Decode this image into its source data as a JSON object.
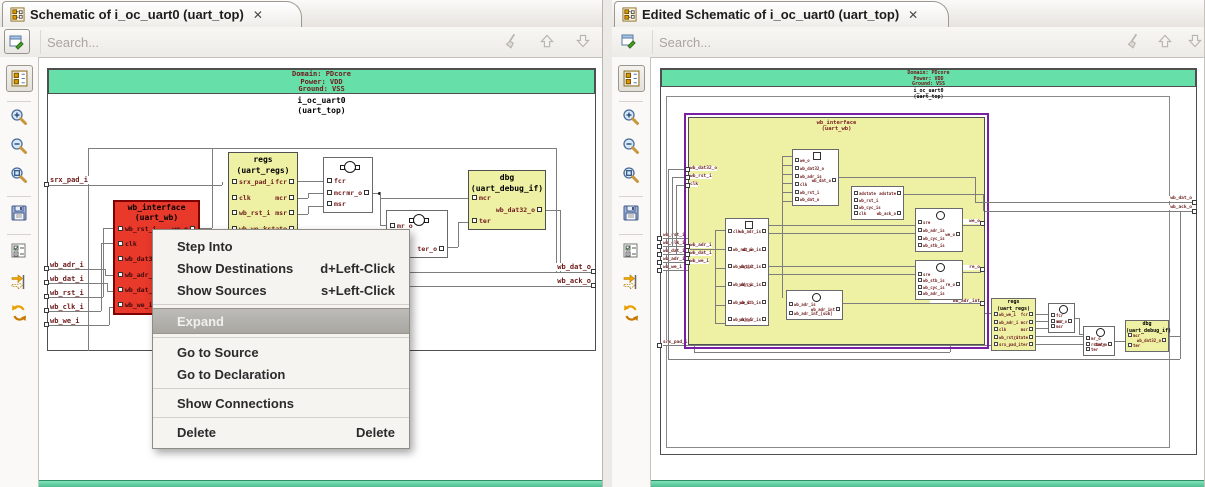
{
  "left_pane": {
    "tab_title": "Schematic of i_oc_uart0 (uart_top)",
    "close_glyph": "✕",
    "search_placeholder": "Search...",
    "banner": {
      "domain": "Domain: PDcore",
      "power": "Power: VDD",
      "ground": "Ground: VSS",
      "instance": "i_oc_uart0",
      "module": "(uart_top)"
    },
    "input_ports": [
      "srx_pad_i",
      "wb_adr_i",
      "wb_dat_i",
      "wb_rst_i",
      "wb_clk_i",
      "wb_we_i"
    ],
    "output_ports": [
      "wb_dat_o",
      "wb_ack_o"
    ],
    "blocks": {
      "wb_interface": {
        "title": "wb_interface",
        "subtitle": "(uart_wb)",
        "left_pins": [
          "wb_rst_i",
          "clk",
          "wb_dat32_o",
          "wb_adr_i",
          "wb_dat_i",
          "wb_we_i"
        ],
        "right_pins": [
          "we_o"
        ]
      },
      "regs": {
        "title": "regs",
        "subtitle": "(uart_regs)",
        "left_pins": [
          "srx_pad_i",
          "clk",
          "wb_rst_i",
          "wb_we_i"
        ],
        "right_pins": [
          "fcr",
          "mcr",
          "msr",
          "rstate"
        ]
      },
      "logic1": {
        "left_pins": [
          "fcr",
          "mcr",
          "msr"
        ],
        "right_pins": [
          "mr_o"
        ]
      },
      "logic2": {
        "left_pins": [
          "mr_o"
        ],
        "right_pins": [
          "ter_o"
        ]
      },
      "dbg": {
        "title": "dbg",
        "subtitle": "(uart_debug_if)",
        "left_pins": [
          "mcr",
          "ter"
        ],
        "right_pins": [
          "wb_dat32_o"
        ]
      }
    },
    "context_menu": {
      "items": [
        {
          "label": "Step Into",
          "shortcut": ""
        },
        {
          "label": "Show Destinations",
          "shortcut": "d+Left-Click"
        },
        {
          "label": "Show Sources",
          "shortcut": "s+Left-Click"
        },
        {
          "label": "Expand",
          "shortcut": ""
        },
        {
          "label": "Go to Source",
          "shortcut": ""
        },
        {
          "label": "Go to Declaration",
          "shortcut": ""
        },
        {
          "label": "Show Connections",
          "shortcut": ""
        },
        {
          "label": "Delete",
          "shortcut": "Delete"
        }
      ]
    }
  },
  "right_pane": {
    "tab_title": "Edited Schematic of i_oc_uart0 (uart_top)",
    "close_glyph": "✕",
    "search_placeholder": "Search...",
    "banner": {
      "domain": "Domain: PDcore",
      "power": "Power: VDD",
      "ground": "Ground: VSS",
      "instance": "i_oc_uart0",
      "module": "(uart_top)"
    },
    "input_ports": [
      "wb_rst_i",
      "wb_clk_i",
      "wb_dat_i",
      "wb_adr_i",
      "wb_we_i",
      "srx_pad_i"
    ],
    "output_ports": [
      "wb_dat_o",
      "wb_ack_o"
    ],
    "expanded": {
      "title": "wb_interface",
      "subtitle": "(uart_wb)",
      "edge_inputs_top": [
        "wb_dat32_o",
        "wb_rst_i",
        "clk"
      ],
      "edge_inputs_mid": [
        "wb_adr_i",
        "wb_dat_i",
        "wb_we_i"
      ],
      "edge_outputs": [
        "we_o",
        "re_o",
        "wb_adr_int"
      ],
      "sub_blocks": {
        "sync": {
          "left_pins": [
            "clk",
            "wb_rst_i",
            "wb_dat_i",
            "wb_adr_i",
            "wb_we_i",
            "wb_ack_i"
          ],
          "right_pins": [
            "wb_adr_is",
            "wb_we_is",
            "wb_dat_is",
            "wb_cyc_is",
            "wb_stb_is",
            "wb_adr_is"
          ]
        },
        "dat": {
          "left_pins": [
            "we_o",
            "wb_dat32_o",
            "wb_adr_is",
            "clk",
            "wb_rst_i",
            "wb_dat_o"
          ],
          "right_pins": [
            "wb_dat_o"
          ]
        },
        "ack": {
          "left_pins": [
            "adstate",
            "wb_rst_i",
            "wb_cyc_is",
            "clk"
          ],
          "right_pins": [
            "adstate",
            "wb_ack_o"
          ]
        },
        "we": {
          "left_pins": [
            "sre",
            "wb_adr_is",
            "wb_cyc_is",
            "wb_stb_is"
          ],
          "right_pins": [
            "we_o"
          ]
        },
        "re": {
          "left_pins": [
            "sre",
            "wb_stb_is",
            "wb_cyc_is",
            "wb_adr_is"
          ],
          "right_pins": [
            "re_o"
          ]
        },
        "adr": {
          "left_pins": [
            "wb_adr_is",
            "wb_adr_int_[sub]"
          ],
          "right_pins": [
            "wb_adr_int"
          ]
        }
      }
    },
    "blocks": {
      "regs": {
        "title": "regs",
        "subtitle": "(uart_regs)",
        "left_pins": [
          "wb_we_i",
          "wb_adr_i",
          "clk",
          "wb_rst_i",
          "srx_pad_i"
        ],
        "right_pins": [
          "fcr",
          "mcr",
          "msr",
          "rstate",
          "ter"
        ]
      },
      "logic1": {
        "left_pins": [
          "fcr",
          "mcr",
          "msr"
        ],
        "right_pins": [
          "mr_o"
        ]
      },
      "logic2": {
        "left_pins": [
          "mr_o",
          "rstate",
          "ter"
        ],
        "right_pins": [
          "ter_o"
        ]
      },
      "dbg": {
        "title": "dbg",
        "subtitle": "(uart_debug_if)",
        "left_pins": [
          "mcr",
          "ter"
        ],
        "right_pins": [
          "wb_dat32_o"
        ]
      }
    }
  }
}
